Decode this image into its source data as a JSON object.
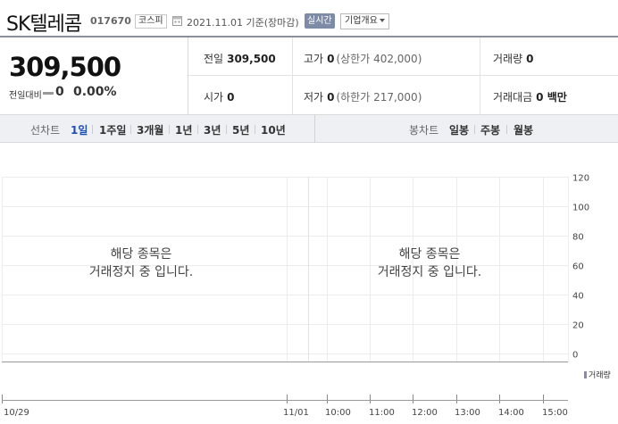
{
  "header": {
    "company_name": "SK텔레콤",
    "stock_code": "017670",
    "market_badge": "코스피",
    "date_text": "2021.11.01 기준(장마감)",
    "realtime_badge": "실시간",
    "overview_button": "기업개요"
  },
  "price": {
    "current": "309,500",
    "change_label": "전일대비",
    "change_value": "0",
    "change_percent": "0.00%"
  },
  "quote": {
    "prev_close": {
      "label": "전일",
      "value": "309,500"
    },
    "high": {
      "label": "고가",
      "value": "0",
      "limit": "(상한가 402,000)"
    },
    "volume": {
      "label": "거래량",
      "value": "0"
    },
    "open": {
      "label": "시가",
      "value": "0"
    },
    "low": {
      "label": "저가",
      "value": "0",
      "limit": "(하한가 217,000)"
    },
    "amount": {
      "label": "거래대금",
      "value": "0 백만"
    }
  },
  "period_bar": {
    "line_chart_label": "선차트",
    "line_periods": [
      "1일",
      "1주일",
      "3개월",
      "1년",
      "3년",
      "5년",
      "10년"
    ],
    "active_period": "1일",
    "candle_label": "봉차트",
    "candle_periods": [
      "일봉",
      "주봉",
      "월봉"
    ]
  },
  "chart_messages": {
    "left_line1": "해당 종목은",
    "left_line2": "거래정지 중 입니다.",
    "right_line1": "해당 종목은",
    "right_line2": "거래정지 중 입니다."
  },
  "chart_data": {
    "type": "line",
    "y_ticks": [
      "120",
      "100",
      "80",
      "60",
      "40",
      "20",
      "0"
    ],
    "ylim": [
      0,
      120
    ],
    "x_ticks": [
      "10/29",
      "11/01",
      "10:00",
      "11:00",
      "12:00",
      "13:00",
      "14:00",
      "15:00"
    ],
    "series": [],
    "volume_legend": "거래량",
    "grid": true
  },
  "colors": {
    "active_period": "#1e4fb3",
    "realtime_badge": "#7e8ba6",
    "period_bar_bg": "#eef0f3"
  }
}
